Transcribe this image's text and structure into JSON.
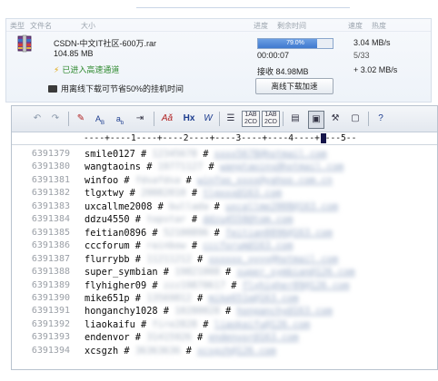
{
  "download": {
    "headers": [
      "类型",
      "文件名",
      "大小",
      "进度",
      "剩余时间",
      "速度",
      "热度"
    ],
    "file_name": "CSDN-中文IT社区-600万.rar",
    "file_size": "104.85 MB",
    "accel_status": "已进入高速通道",
    "tip": "用离线下载可节省50%的挂机时间",
    "progress": {
      "percent": 79.0,
      "label": "79.0%"
    },
    "eta": "00:00:07",
    "received": "接收 84.98MB",
    "speed": "3.04 MB/s",
    "peers": "5/33",
    "offline_speed": "+ 3.02 MB/s",
    "offline_button": "离线下载加速"
  },
  "editor": {
    "ruler": "----+----1----+----2----+----3----+----4----+----5--",
    "rows": [
      {
        "ln": "6391379",
        "user": "smile0127",
        "pw": "12345678",
        "email": "xxxx5678@hotmail.com"
      },
      {
        "ln": "6391380",
        "user": "wangtaoins",
        "pw": "19771127",
        "email": "wangtaoins@hotmail.com"
      },
      {
        "ln": "6391381",
        "user": "winfoo",
        "pw": "fdsafdsa",
        "email": "winfoo_xxxx@yahoo.com.cn"
      },
      {
        "ln": "6391382",
        "user": "tlgxtwy",
        "pw": "20082010",
        "email": "tlgxxx@163.com"
      },
      {
        "ln": "6391383",
        "user": "uxcallme2008",
        "pw": "bullada",
        "email": "uxcallme2008@163.com"
      },
      {
        "ln": "6391384",
        "user": "ddzu4550",
        "pw": "topstar",
        "email": "ddzu4550@tom.com"
      },
      {
        "ln": "6391385",
        "user": "feitian0896",
        "pw": "52100896",
        "email": "feitian0896@163.com"
      },
      {
        "ln": "6391386",
        "user": "cccforum",
        "pw": "rainbow",
        "email": "cccforum@163.com"
      },
      {
        "ln": "6391387",
        "user": "flurrybb",
        "pw": "11211212",
        "email": "xxxxxx_yyyy@hotmail.com"
      },
      {
        "ln": "6391388",
        "user": "super_symbian",
        "pw": "19821008",
        "email": "super_symbian@126.com"
      },
      {
        "ln": "6391389",
        "user": "flyhigher09",
        "pw": "zzz19870617",
        "email": "flyhigher09@126.com"
      },
      {
        "ln": "6391390",
        "user": "mike651p",
        "pw": "13569812",
        "email": "mike651p@163.com"
      },
      {
        "ln": "6391391",
        "user": "honganchy1028",
        "pw": "10280028",
        "email": "honganchy@163.com"
      },
      {
        "ln": "6391392",
        "user": "liaokaifu",
        "pw": "fire2828",
        "email": "liaokaifu@126.com"
      },
      {
        "ln": "6391393",
        "user": "endenvor",
        "pw": "31415926",
        "email": "endenvor@163.com"
      },
      {
        "ln": "6391394",
        "user": "xcsgzh",
        "pw": "36363636",
        "email": "xcsgzh@126.com"
      }
    ]
  }
}
